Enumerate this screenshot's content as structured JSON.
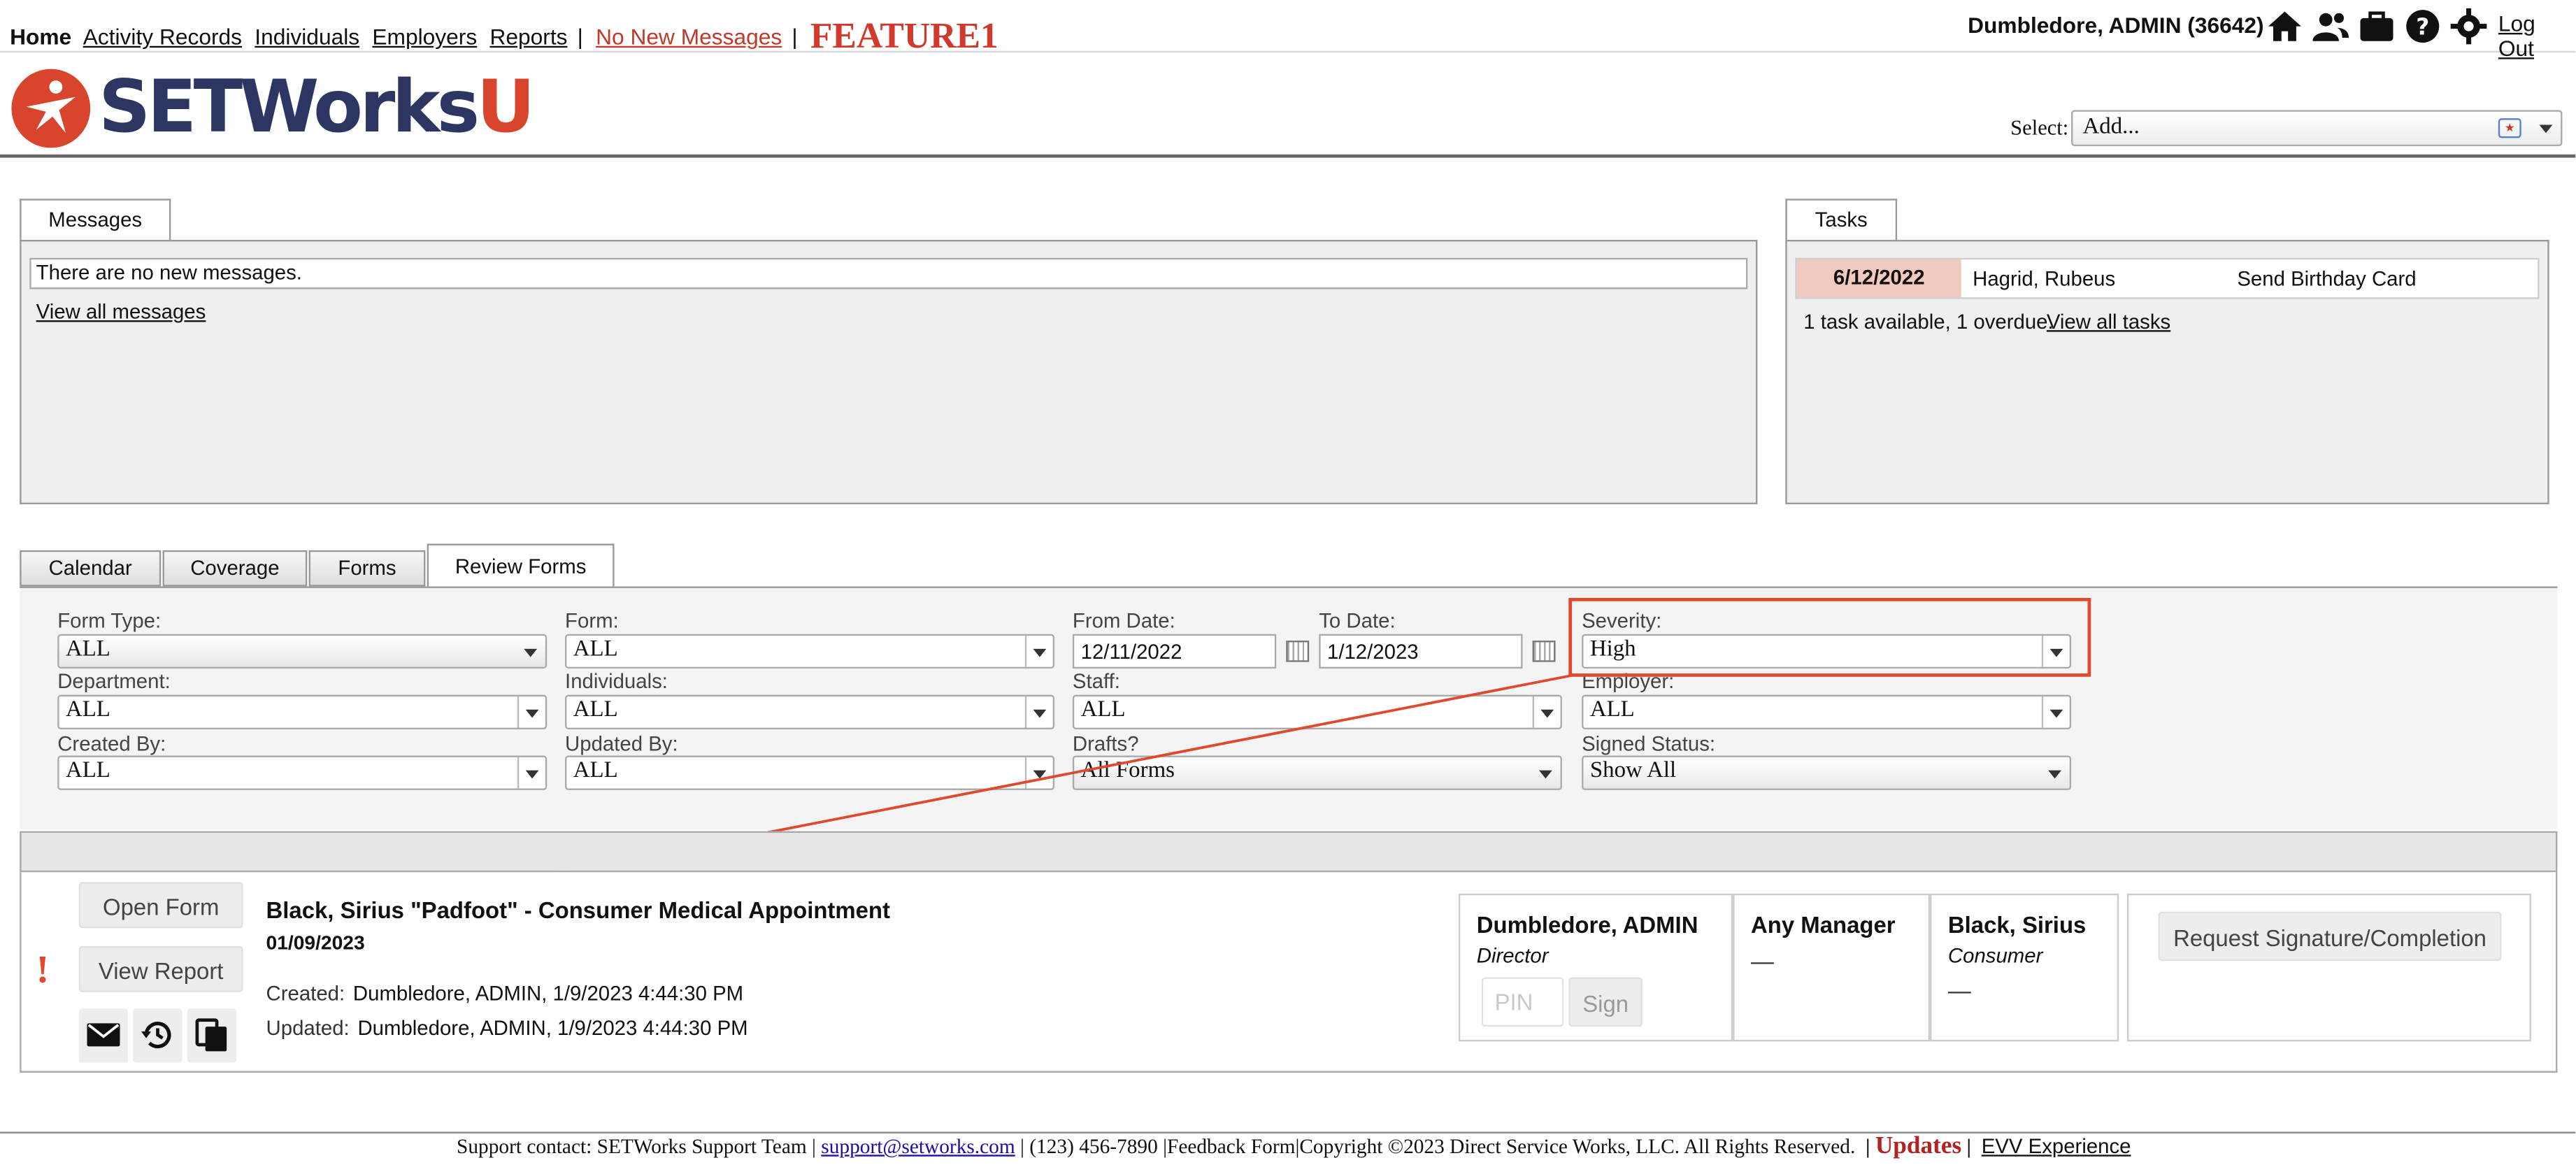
{
  "topnav": {
    "home": "Home",
    "activity_records": "Activity Records",
    "individuals": "Individuals",
    "employers": "Employers",
    "reports": "Reports",
    "messages": "No New Messages",
    "feature": "FEATURE1",
    "user": "Dumbledore, ADMIN  (36642)",
    "logout": "Log Out",
    "icons": [
      "home-icon",
      "users-icon",
      "briefcase-icon",
      "help-icon",
      "gear-icon"
    ]
  },
  "header": {
    "logo_text": "SETWorks",
    "logo_suffix": "U",
    "select_label": "Select:",
    "select_value": "Add..."
  },
  "messages": {
    "tab": "Messages",
    "text": "There are no new messages.",
    "view_all": "View all messages"
  },
  "tasks": {
    "tab": "Tasks",
    "rows": [
      {
        "date": "6/12/2022",
        "name": "Hagrid, Rubeus",
        "desc": "Send Birthday Card"
      }
    ],
    "summary": "1 task available, 1 overdue.",
    "view_all": "View all tasks"
  },
  "tabs": [
    "Calendar",
    "Coverage",
    "Forms",
    "Review Forms"
  ],
  "filters": {
    "form_type": {
      "label": "Form Type:",
      "value": "ALL"
    },
    "form": {
      "label": "Form:",
      "value": "ALL"
    },
    "from_date": {
      "label": "From Date:",
      "value": "12/11/2022"
    },
    "to_date": {
      "label": "To Date:",
      "value": "1/12/2023"
    },
    "severity": {
      "label": "Severity:",
      "value": "High"
    },
    "department": {
      "label": "Department:",
      "value": "ALL"
    },
    "individuals": {
      "label": "Individuals:",
      "value": "ALL"
    },
    "staff": {
      "label": "Staff:",
      "value": "ALL"
    },
    "employer": {
      "label": "Employer:",
      "value": "ALL"
    },
    "created_by": {
      "label": "Created By:",
      "value": "ALL"
    },
    "updated_by": {
      "label": "Updated By:",
      "value": "ALL"
    },
    "drafts": {
      "label": "Drafts?",
      "value": "All Forms"
    },
    "signed_status": {
      "label": "Signed Status:",
      "value": "Show All"
    }
  },
  "result": {
    "open_form": "Open Form",
    "view_report": "View Report",
    "title": "Black, Sirius \"Padfoot\" - Consumer Medical Appointment",
    "date": "01/09/2023",
    "created_label": "Created:",
    "created_value": "Dumbledore, ADMIN, 1/9/2023 4:44:30 PM",
    "updated_label": "Updated:",
    "updated_value": "Dumbledore, ADMIN, 1/9/2023 4:44:30 PM",
    "severity_marker": "!",
    "action_icons": [
      "email-icon",
      "history-icon",
      "copy-icon"
    ],
    "signers": [
      {
        "name": "Dumbledore, ADMIN",
        "role": "Director"
      },
      {
        "name": "Any Manager",
        "role": "",
        "dash": "—"
      },
      {
        "name": "Black, Sirius",
        "role": "Consumer",
        "dash": "—"
      }
    ],
    "pin_placeholder": "PIN",
    "sign": "Sign",
    "request": "Request Signature/Completion"
  },
  "footer": {
    "support": "Support contact: SETWorks Support Team |",
    "email": "support@setworks.com",
    "rest": "| (123) 456-7890 |Feedback Form|Copyright ©2023 Direct Service Works, LLC. All Rights Reserved.",
    "updates": "Updates",
    "evv": "EVV Experience"
  },
  "colors": {
    "accent": "#e0492c",
    "brand_navy": "#2d3563",
    "task_highlight": "#f2c9bf"
  }
}
